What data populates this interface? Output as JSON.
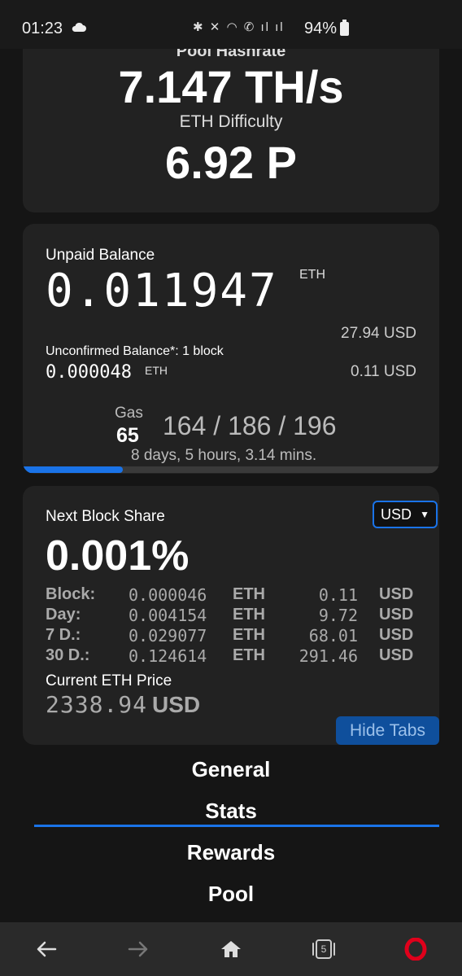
{
  "status_bar": {
    "time": "01:23",
    "icons": "✱ ✕ ◠ ✆ ıl ıl",
    "battery": "94%"
  },
  "pool_card": {
    "cut_label": "Pool Hashrate",
    "hashrate": "7.147 TH/s",
    "difficulty_label": "ETH Difficulty",
    "difficulty": "6.92 P"
  },
  "balance_card": {
    "label": "Unpaid Balance",
    "balance": "0.011947",
    "unit": "ETH",
    "usd": "27.94 USD",
    "unconfirmed_label": "Unconfirmed Balance*: 1 block",
    "unconfirmed_value": "0.000048",
    "unconfirmed_unit": "ETH",
    "unconfirmed_usd": "0.11 USD",
    "gas_label": "Gas",
    "gas_value": "65",
    "gas_prices": "164 / 186 / 196",
    "timer": "8 days, 5 hours, 3.14 mins.",
    "progress_fraction": 0.24
  },
  "share_card": {
    "label": "Next Block Share",
    "currency_selected": "USD",
    "share": "0.001%",
    "rows": [
      {
        "label": "Block:",
        "amount": "0.000046",
        "unit": "ETH",
        "fiat": "0.11",
        "currency": "USD"
      },
      {
        "label": "Day:",
        "amount": "0.004154",
        "unit": "ETH",
        "fiat": "9.72",
        "currency": "USD"
      },
      {
        "label": "7 D.:",
        "amount": "0.029077",
        "unit": "ETH",
        "fiat": "68.01",
        "currency": "USD"
      },
      {
        "label": "30 D.:",
        "amount": "0.124614",
        "unit": "ETH",
        "fiat": "291.46",
        "currency": "USD"
      }
    ],
    "price_label": "Current ETH Price",
    "price_value": "2338.94",
    "price_currency": "USD",
    "hide_tabs_label": "Hide Tabs"
  },
  "tabs": {
    "general": "General",
    "stats": "Stats",
    "rewards": "Rewards",
    "pool": "Pool",
    "active": "Stats"
  },
  "bottom_nav": {
    "tab_count": "5",
    "accent_color": "#e0001b"
  },
  "colors": {
    "accent_blue": "#1a73e8",
    "card_bg": "#222222",
    "page_bg": "#151515"
  }
}
